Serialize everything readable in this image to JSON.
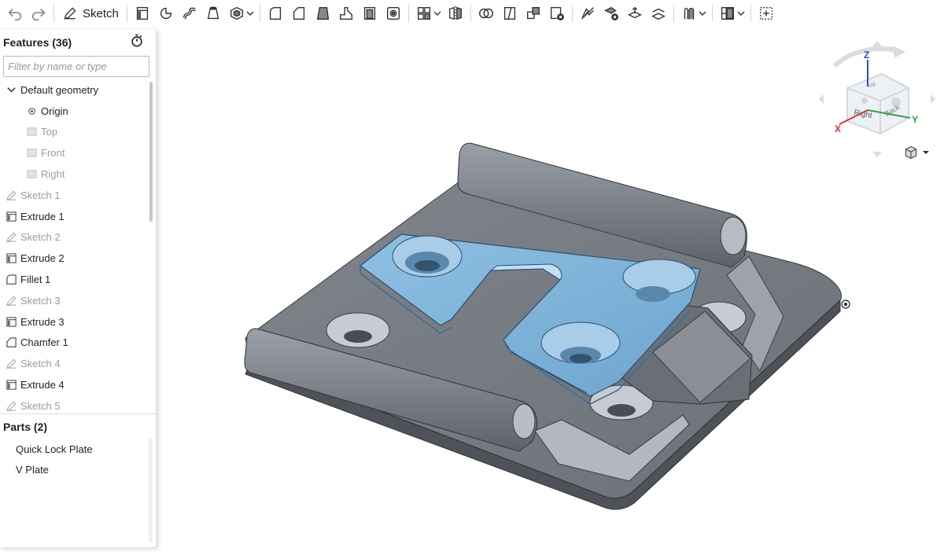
{
  "toolbar": {
    "sketch_label": "Sketch",
    "icons": [
      "undo-icon",
      "redo-icon",
      "sketch-icon",
      "extrude-icon",
      "revolve-icon",
      "sweep-icon",
      "loft-icon",
      "thicken-icon",
      "fillet-icon",
      "chamfer-icon",
      "draft-icon",
      "rib-icon",
      "shell-icon",
      "hole-icon",
      "pattern-icon",
      "mirror-icon",
      "boolean-icon",
      "split-icon",
      "transform-icon",
      "delete-part-icon",
      "modify-fillet-icon",
      "delete-face-icon",
      "move-face-icon",
      "replace-face-icon",
      "offset-surface-icon",
      "plane-icon",
      "add-feature-icon"
    ]
  },
  "features_panel": {
    "title": "Features (36)",
    "filter_placeholder": "Filter by name or type",
    "items": [
      {
        "label": "Default geometry",
        "icon": "chevron-down-icon",
        "level": 0,
        "muted": false
      },
      {
        "label": "Origin",
        "icon": "origin-icon",
        "level": 1,
        "muted": false
      },
      {
        "label": "Top",
        "icon": "plane-icon",
        "level": 1,
        "muted": true
      },
      {
        "label": "Front",
        "icon": "plane-icon",
        "level": 1,
        "muted": true
      },
      {
        "label": "Right",
        "icon": "plane-icon",
        "level": 1,
        "muted": true
      },
      {
        "label": "Sketch 1",
        "icon": "sketch-icon",
        "level": 0,
        "muted": true
      },
      {
        "label": "Extrude 1",
        "icon": "extrude-icon",
        "level": 0,
        "muted": false
      },
      {
        "label": "Sketch 2",
        "icon": "sketch-icon",
        "level": 0,
        "muted": true
      },
      {
        "label": "Extrude 2",
        "icon": "extrude-icon",
        "level": 0,
        "muted": false
      },
      {
        "label": "Fillet 1",
        "icon": "fillet-icon",
        "level": 0,
        "muted": false
      },
      {
        "label": "Sketch 3",
        "icon": "sketch-icon",
        "level": 0,
        "muted": true
      },
      {
        "label": "Extrude 3",
        "icon": "extrude-icon",
        "level": 0,
        "muted": false
      },
      {
        "label": "Chamfer 1",
        "icon": "chamfer-icon",
        "level": 0,
        "muted": false
      },
      {
        "label": "Sketch 4",
        "icon": "sketch-icon",
        "level": 0,
        "muted": true
      },
      {
        "label": "Extrude 4",
        "icon": "extrude-icon",
        "level": 0,
        "muted": false
      },
      {
        "label": "Sketch 5",
        "icon": "sketch-icon",
        "level": 0,
        "muted": true
      }
    ]
  },
  "parts_panel": {
    "title": "Parts (2)",
    "items": [
      "Quick Lock Plate",
      "V Plate"
    ]
  },
  "view_cube": {
    "axis_z": "Z",
    "axis_x": "X",
    "axis_y": "Y",
    "face_right": "Right",
    "face_back": "Back",
    "face_top": "Top"
  },
  "colors": {
    "part_gray": "#6f747b",
    "selected_blue": "#7fb0d6",
    "axis_x": "#e0303a",
    "axis_y": "#2fa14a",
    "axis_z": "#2e48c8"
  }
}
